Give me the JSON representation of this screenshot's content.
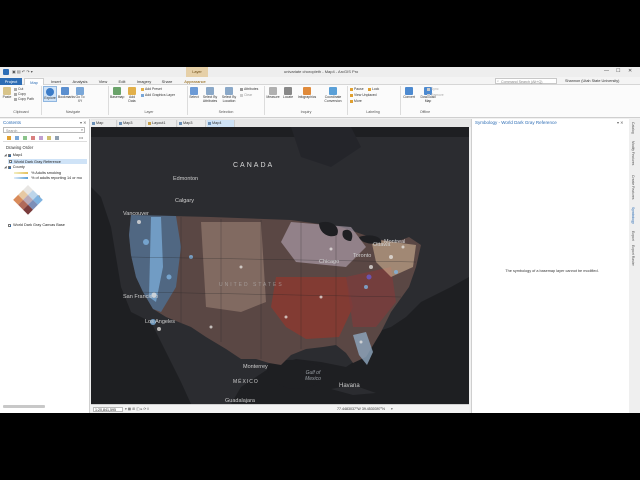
{
  "window": {
    "title": "univariate choropleth - Map4 - ArcGIS Pro",
    "context_tab_group": "Layer",
    "search_placeholder": "Command Search (Alt+Q)",
    "user": "Shannon (Utah State University)",
    "minimize": "—",
    "maximize": "☐",
    "close": "✕"
  },
  "ribbon_tabs": [
    "Project",
    "Map",
    "Insert",
    "Analysis",
    "View",
    "Edit",
    "Imagery",
    "Share",
    "Appearance"
  ],
  "ribbon": {
    "clipboard": {
      "label": "Clipboard",
      "paste": "Paste",
      "cut": "Cut",
      "copy": "Copy",
      "copy_path": "Copy Path"
    },
    "navigate": {
      "label": "Navigate",
      "explore": "Explore",
      "bookmarks": "Bookmarks",
      "go_to_xy": "Go To XY"
    },
    "layer": {
      "label": "Layer",
      "basemap": "Basemap",
      "add_data": "Add Data",
      "add_preset": "Add Preset",
      "add_graphics": "Add Graphics Layer"
    },
    "selection": {
      "label": "Selection",
      "select": "Select",
      "select_by_attr": "Select By Attributes",
      "select_by_loc": "Select By Location",
      "attributes": "Attributes",
      "clear": "Clear"
    },
    "inquiry": {
      "label": "Inquiry",
      "measure": "Measure",
      "locate": "Locate",
      "infographics": "Infographics",
      "coordinate": "Coordinate Conversion"
    },
    "labeling": {
      "label": "Labeling",
      "pause": "Pause",
      "lock": "Lock",
      "view_unplaced": "View Unplaced",
      "more": "More"
    },
    "offline": {
      "label": "Offline",
      "convert": "Convert",
      "download_map": "Download Map",
      "sync": "Sync",
      "remove": "Remove"
    }
  },
  "doc_tabs": [
    "Map",
    "Map3",
    "Layout1",
    "Map3",
    "Map4"
  ],
  "contents": {
    "title": "Contents",
    "search_placeholder": "Search",
    "drawing_order": "Drawing Order",
    "map_name": "Map4",
    "layer_ref": "World Dark Gray Reference",
    "layer_county": "County",
    "legend_1": "% Adults smoking",
    "legend_2": "% of adults reporting 14 or mo",
    "layer_base": "World Dark Gray Canvas Base"
  },
  "map_labels": {
    "canada": "CANADA",
    "edmonton": "Edmonton",
    "calgary": "Calgary",
    "vancouver": "Vancouver",
    "ottawa": "Ottawa",
    "montreal": "Montreal",
    "toronto": "Toronto",
    "chicago": "Chicago",
    "san_francisco": "San Francisco",
    "los_angeles": "Los Angeles",
    "monterrey": "Monterrey",
    "mexico": "MÉXICO",
    "gulf": "Gulf of Mexico",
    "havana": "Havana",
    "guadalajara": "Guadalajara",
    "usa": "UNITED STATES"
  },
  "status": {
    "scale": "1:20,841,595",
    "coords": "77.4483037°W 39.4530397°N"
  },
  "symbology": {
    "title": "Symbology - World Dark Gray Reference",
    "message": "The symbology of a basemap layer cannot be modified."
  },
  "right_tabs": [
    "Catalog",
    "Modify Features",
    "Create Features",
    "Symbology",
    "Export",
    "Export Raster"
  ],
  "colors": {
    "accent": "#2d6db5",
    "map_bg": "#1e1f22",
    "bivariate_high": "#9c3c2e",
    "bivariate_low": "#7fb3e0"
  }
}
